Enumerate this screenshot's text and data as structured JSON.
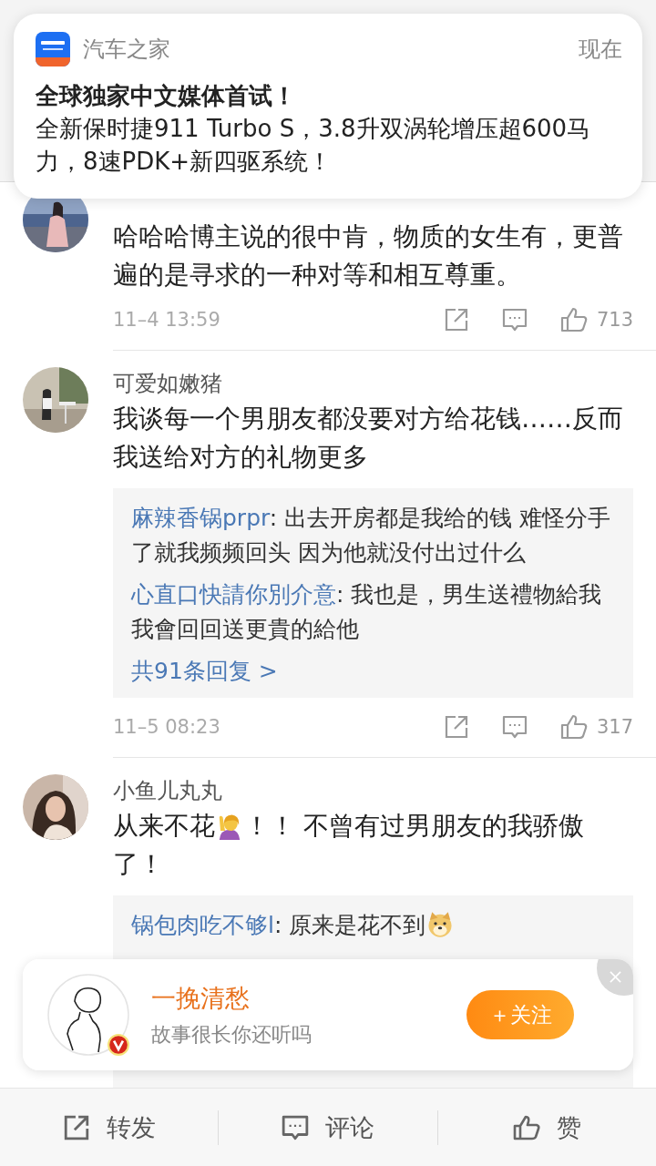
{
  "notification": {
    "app": "汽车之家",
    "time": "现在",
    "title": "全球独家中文媒体首试！",
    "body": "全新保时捷911 Turbo S，3.8升双涡轮增压超600马力，8速PDK+新四驱系统！"
  },
  "comments": [
    {
      "text": [
        [
          "哈哈哈博主说的很中肯，物质的女生有，更普遍的是寻求的一种对等和相互尊重。"
        ]
      ],
      "time": "11–4 13:59",
      "likes": "713"
    },
    {
      "user": "可爱如嫩猪",
      "text": [
        [
          "我谈每一个男朋友都没要对方给花钱……反而我送给对方的礼物更多"
        ]
      ],
      "replies": [
        {
          "user": "麻辣香锅prpr",
          "text": ": 出去开房都是我给的钱 难怪分手了就我频频回头 因为他就没付出过什么"
        },
        {
          "user": "心直口快請你別介意",
          "text": ": 我也是，男生送禮物給我我會回回送更貴的給他"
        }
      ],
      "more_replies": "共91条回复 >",
      "time": "11–5 08:23",
      "likes": "317"
    },
    {
      "user": "小鱼儿丸丸",
      "text": [
        [
          "从来不花",
          "！！ 不曾有过男朋友的我骄傲"
        ],
        [
          "了！"
        ]
      ],
      "replies": [
        {
          "user": "锅包肉吃不够l",
          "text": ": 原来是花不到",
          "emoji": true
        }
      ]
    }
  ],
  "follow_popup": {
    "name": "一挽清愁",
    "bio": "故事很长你还听吗",
    "verified": true,
    "button": "＋关注"
  },
  "bottom_bar": [
    {
      "kind": "share",
      "label": "转发"
    },
    {
      "kind": "comment",
      "label": "评论"
    },
    {
      "kind": "like",
      "label": "赞"
    }
  ]
}
